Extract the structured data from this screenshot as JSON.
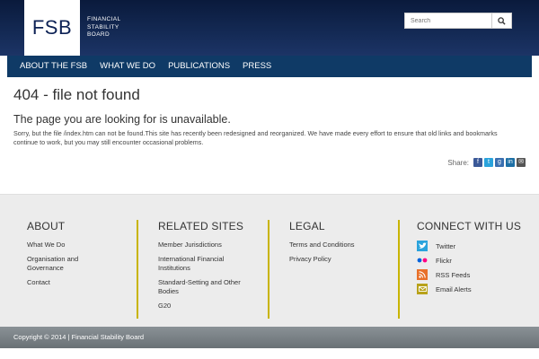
{
  "header": {
    "logo": "FSB",
    "logo_words": [
      "FINANCIAL",
      "STABILITY",
      "BOARD"
    ],
    "search_placeholder": "Search"
  },
  "nav": [
    {
      "label": "About the FSB"
    },
    {
      "label": "What We Do"
    },
    {
      "label": "Publications"
    },
    {
      "label": "Press"
    }
  ],
  "main": {
    "title": "404 - file not found",
    "subtitle": "The page you are looking for is unavailable.",
    "message": "Sorry, but the file /index.htm can not be found.This site has recently been redesigned and reorganized. We have made every effort to ensure that old links and bookmarks continue to work, but you may still encounter occasional problems.",
    "share_label": "Share:",
    "share_icons": [
      "facebook-icon",
      "twitter-icon",
      "google-plus-icon",
      "linkedin-icon",
      "email-icon"
    ]
  },
  "footer": {
    "about": {
      "title": "About",
      "links": [
        "What We Do",
        "Organisation and Governance",
        "Contact"
      ]
    },
    "related": {
      "title": "Related Sites",
      "links": [
        "Member Jurisdictions",
        "International Financial Institutions",
        "Standard-Setting and Other Bodies",
        "G20"
      ]
    },
    "legal": {
      "title": "Legal",
      "links": [
        "Terms and Conditions",
        "Privacy Policy"
      ]
    },
    "connect": {
      "title": "Connect with us",
      "items": [
        {
          "label": "Twitter",
          "icon": "twitter-icon",
          "color": "#2aa3dc"
        },
        {
          "label": "Flickr",
          "icon": "flickr-icon",
          "color": "#ff0084"
        },
        {
          "label": "RSS Feeds",
          "icon": "rss-icon",
          "color": "#e8702a"
        },
        {
          "label": "Email Alerts",
          "icon": "email-alerts-icon",
          "color": "#b8a21a"
        }
      ]
    },
    "divider_color": "#c8b400"
  },
  "copyright": "Copyright © 2014 | Financial Stability Board"
}
